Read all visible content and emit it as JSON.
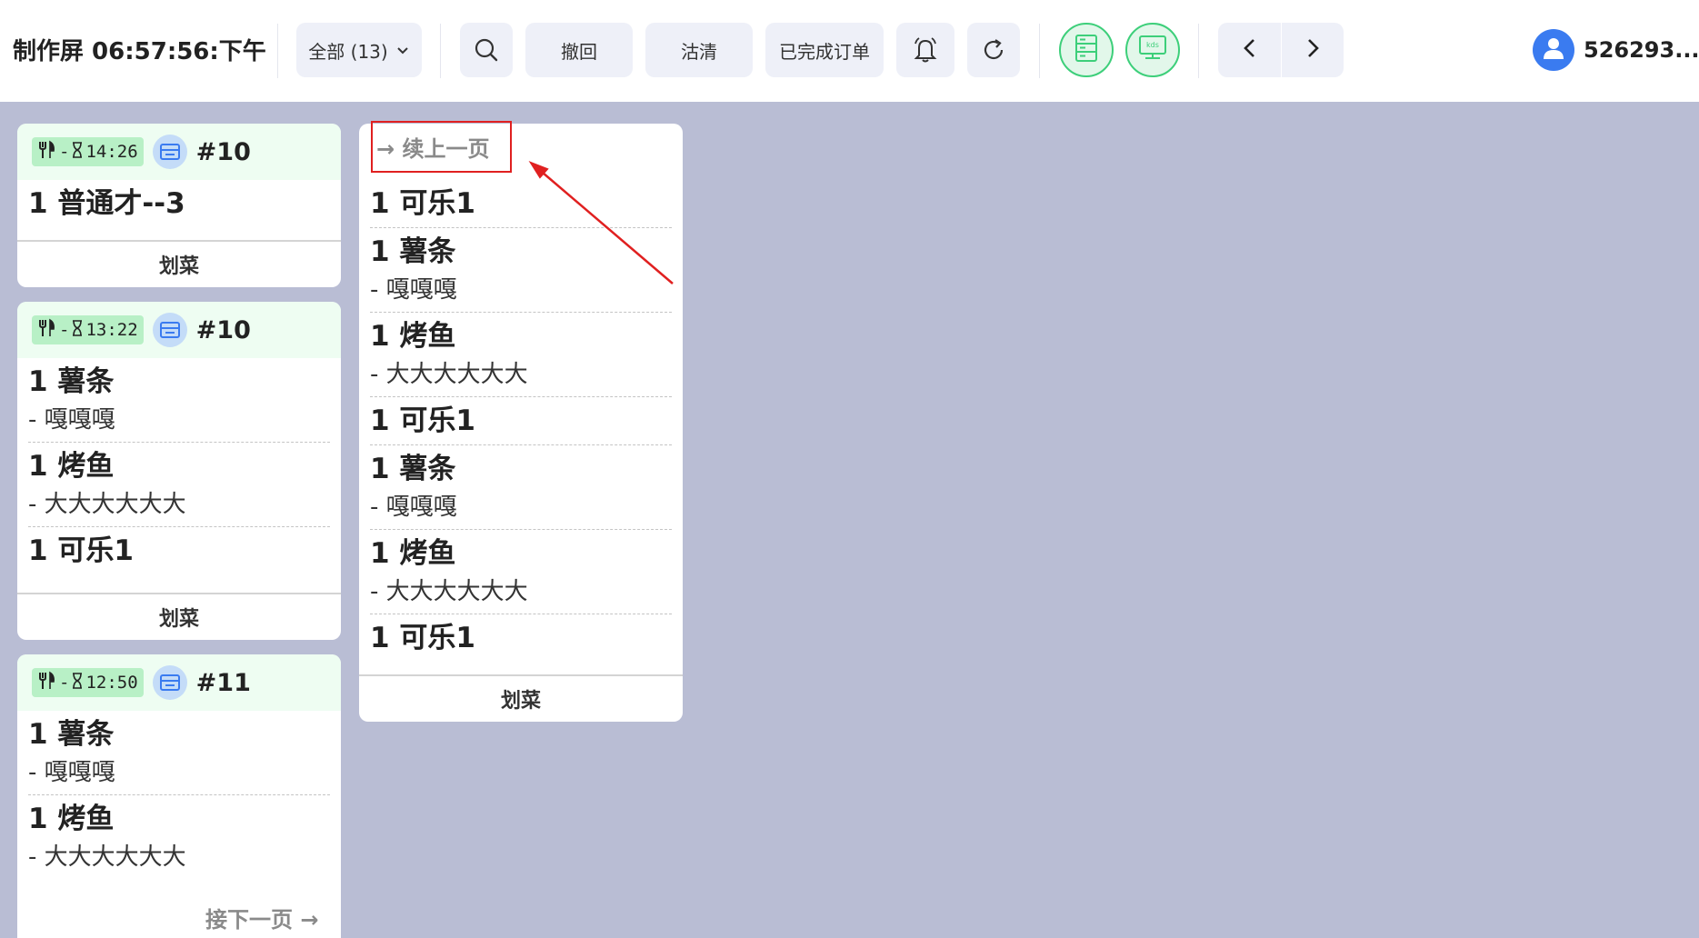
{
  "header": {
    "title": "制作屏 06:57:56:下午",
    "filter_label": "全部 (13)",
    "undo_label": "撤回",
    "soldout_label": "沽清",
    "done_label": "已完成订单",
    "user_name": "526293..."
  },
  "icons": {
    "search": "search-icon",
    "bell": "bell-icon",
    "refresh": "refresh-icon",
    "server": "server-icon",
    "kds": "kds-monitor-icon",
    "prev": "chevron-left-icon",
    "next": "chevron-right-icon",
    "avatar": "user-icon",
    "cutlery": "cutlery-icon",
    "hourglass": "hourglass-icon",
    "store": "store-icon"
  },
  "colors": {
    "background": "#b9bdd4",
    "accent_green": "#3dcf7a",
    "badge_green": "#b8f0c6",
    "avatar_blue": "#3a7bf0",
    "annotation_red": "#e02020"
  },
  "card_action_label": "划菜",
  "cards": [
    {
      "time_prefix": "-",
      "time": "14:26",
      "order_no": "#10",
      "items": [
        {
          "name": "1 普通才--3",
          "mods": []
        }
      ]
    },
    {
      "time_prefix": "-",
      "time": "13:22",
      "order_no": "#10",
      "items": [
        {
          "name": "1 薯条",
          "mods": [
            "- 嘎嘎嘎"
          ]
        },
        {
          "name": "1 烤鱼",
          "mods": [
            "- 大大大大大大"
          ]
        },
        {
          "name": "1 可乐1",
          "mods": []
        }
      ]
    },
    {
      "time_prefix": "-",
      "time": "12:50",
      "order_no": "#11",
      "next_page_label": "接下一页 →",
      "items": [
        {
          "name": "1 薯条",
          "mods": [
            "- 嘎嘎嘎"
          ]
        },
        {
          "name": "1 烤鱼",
          "mods": [
            "- 大大大大大大"
          ]
        }
      ]
    },
    {
      "continue_label": "→ 续上一页",
      "items": [
        {
          "name": "1 可乐1",
          "mods": []
        },
        {
          "name": "1 薯条",
          "mods": [
            "- 嘎嘎嘎"
          ]
        },
        {
          "name": "1 烤鱼",
          "mods": [
            "- 大大大大大大"
          ]
        },
        {
          "name": "1 可乐1",
          "mods": []
        },
        {
          "name": "1 薯条",
          "mods": [
            "- 嘎嘎嘎"
          ]
        },
        {
          "name": "1 烤鱼",
          "mods": [
            "- 大大大大大大"
          ]
        },
        {
          "name": "1 可乐1",
          "mods": []
        }
      ]
    }
  ]
}
